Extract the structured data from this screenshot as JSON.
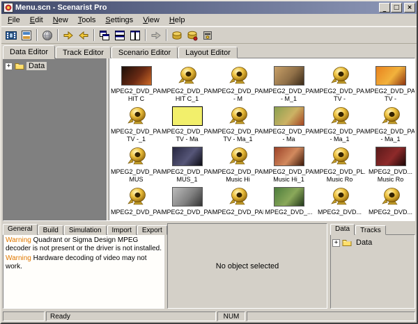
{
  "window": {
    "title": "Menu.scn - Scenarist Pro",
    "controls": {
      "minimize": "_",
      "maximize": "□",
      "close": "×"
    }
  },
  "menu": {
    "items": [
      {
        "label": "File"
      },
      {
        "label": "Edit"
      },
      {
        "label": "New"
      },
      {
        "label": "Tools"
      },
      {
        "label": "Settings"
      },
      {
        "label": "View"
      },
      {
        "label": "Help"
      }
    ]
  },
  "toolbar": {
    "groups": [
      [
        {
          "icon": "film-strip-icon"
        },
        {
          "icon": "storyboard-icon"
        }
      ],
      [
        {
          "icon": "globe-icon"
        }
      ],
      [
        {
          "icon": "export-arrow-icon"
        },
        {
          "icon": "import-arrow-icon"
        }
      ],
      [
        {
          "icon": "window-cascade-icon"
        },
        {
          "icon": "window-tile-icon"
        },
        {
          "icon": "window-layout-icon"
        }
      ],
      [
        {
          "icon": "navigate-icon"
        }
      ],
      [
        {
          "icon": "disc-icon"
        },
        {
          "icon": "disc-write-icon"
        },
        {
          "icon": "jukebox-icon"
        }
      ]
    ]
  },
  "editor_tabs": [
    {
      "label": "Data Editor",
      "active": true
    },
    {
      "label": "Track Editor",
      "active": false
    },
    {
      "label": "Scenario Editor",
      "active": false
    },
    {
      "label": "Layout Editor",
      "active": false
    }
  ],
  "tree": {
    "expand_glyph": "+",
    "root_label": "Data"
  },
  "assets": {
    "items": [
      {
        "type": "video",
        "line1": "MPEG2_DVD_PAL-...",
        "line2": "HIT C",
        "thumb": [
          "#1c0f08",
          "#6a2a14",
          "#cf6a26"
        ]
      },
      {
        "type": "audio",
        "line1": "MPEG2_DVD_PAL-...",
        "line2": "HIT C_1"
      },
      {
        "type": "audio",
        "line1": "MPEG2_DVD_PAL...",
        "line2": "- M"
      },
      {
        "type": "video",
        "line1": "MPEG2_DVD_PAL...",
        "line2": "- M_1",
        "thumb": [
          "#c8a068",
          "#907048",
          "#3a2a18"
        ]
      },
      {
        "type": "audio",
        "line1": "MPEG2_DVD_PA...",
        "line2": "TV -"
      },
      {
        "type": "video",
        "line1": "MPEG2_DVD_PA...",
        "line2": "TV -",
        "thumb": [
          "#e8821e",
          "#f2b23c",
          "#8e3410"
        ]
      },
      {
        "type": "audio",
        "line1": "MPEG2_DVD_PA...",
        "line2": "TV -_1"
      },
      {
        "type": "still",
        "line1": "MPEG2_DVD_PAL-...",
        "line2": "TV - Ma",
        "thumb": [
          "#f2ef6b"
        ]
      },
      {
        "type": "audio",
        "line1": "MPEG2_DVD_PAL-...",
        "line2": "TV - Ma_1"
      },
      {
        "type": "video",
        "line1": "MPEG2_DVD_PAL...",
        "line2": "- Ma",
        "thumb": [
          "#8aa050",
          "#ccb264",
          "#a44422"
        ]
      },
      {
        "type": "audio",
        "line1": "MPEG2_DVD_PAL...",
        "line2": "- Ma_1"
      },
      {
        "type": "audio",
        "line1": "MPEG2_DVD_PA...",
        "line2": "- Ma_1"
      },
      {
        "type": "audio",
        "line1": "MPEG2_DVD_PAL...",
        "line2": "MUS"
      },
      {
        "type": "video",
        "line1": "MPEG2_DVD_PAL...",
        "line2": "MUS_1",
        "thumb": [
          "#262640",
          "#565678",
          "#0c0c14"
        ]
      },
      {
        "type": "audio",
        "line1": "MPEG2_DVD_PAL...",
        "line2": "Music Hi"
      },
      {
        "type": "video",
        "line1": "MPEG2_DVD_PAL...",
        "line2": "Music Hi_1",
        "thumb": [
          "#9c4228",
          "#d28a5e",
          "#3c1808"
        ]
      },
      {
        "type": "audio",
        "line1": "MPEG2_DVD_PL...",
        "line2": "Music Ro"
      },
      {
        "type": "video",
        "line1": "MPEG2_DVD...",
        "line2": "Music Ro",
        "thumb": [
          "#5a1a1a",
          "#8e2a2a",
          "#1e0808"
        ]
      },
      {
        "type": "audio",
        "line1": "MPEG2_DVD_PAL...",
        "line2": ""
      },
      {
        "type": "video",
        "line1": "MPEG2_DVD_PAL...",
        "line2": "",
        "thumb": [
          "#bcbcbc",
          "#808080",
          "#343434"
        ]
      },
      {
        "type": "audio",
        "line1": "MPEG2_DVD_PAL...",
        "line2": ""
      },
      {
        "type": "video",
        "line1": "MPEG2_DVD_...",
        "line2": "",
        "thumb": [
          "#4c7c3c",
          "#8aa85a",
          "#22381a"
        ]
      },
      {
        "type": "audio",
        "line1": "MPEG2_DVD...",
        "line2": ""
      },
      {
        "type": "audio",
        "line1": "MPEG2_DVD...",
        "line2": ""
      }
    ]
  },
  "bottom": {
    "left": {
      "tabs": [
        {
          "label": "General",
          "active": true
        },
        {
          "label": "Build",
          "active": false
        },
        {
          "label": "Simulation",
          "active": false
        },
        {
          "label": "Import",
          "active": false
        },
        {
          "label": "Export",
          "active": false
        }
      ],
      "warnings": [
        {
          "label": "Warning",
          "text": "Quadrant or Sigma Design MPEG decoder is not present or the driver is not installed."
        },
        {
          "label": "Warning",
          "text": "Hardware decoding of video may not work."
        }
      ]
    },
    "middle": {
      "message": "No object selected"
    },
    "right": {
      "tabs": [
        {
          "label": "Data",
          "active": true
        },
        {
          "label": "Tracks",
          "active": false
        }
      ],
      "expand_glyph": "+",
      "tree_root": "Data"
    }
  },
  "statusbar": {
    "message": "Ready",
    "num": "NUM"
  },
  "colors": {
    "titlebar_start": "#414a6b",
    "titlebar_end": "#8e98b8",
    "chrome": "#d4d0c8",
    "workspace": "#808080",
    "warning": "#e07800",
    "selection_yellow": "#f2ef6b"
  }
}
